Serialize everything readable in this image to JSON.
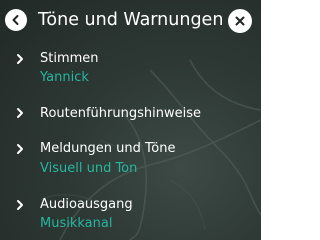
{
  "header": {
    "title": "Töne und Warnungen",
    "back_icon": "chevron-left-icon",
    "close_icon": "close-icon"
  },
  "menu": {
    "items": [
      {
        "label": "Stimmen",
        "value": "Yannick"
      },
      {
        "label": "Routenführungshinweise",
        "value": ""
      },
      {
        "label": "Meldungen und Töne",
        "value": "Visuell und Ton"
      },
      {
        "label": "Audioausgang",
        "value": "Musikkanal"
      }
    ]
  },
  "colors": {
    "accent": "#27b6a0",
    "text": "#ffffff",
    "background": "#2d3834"
  }
}
